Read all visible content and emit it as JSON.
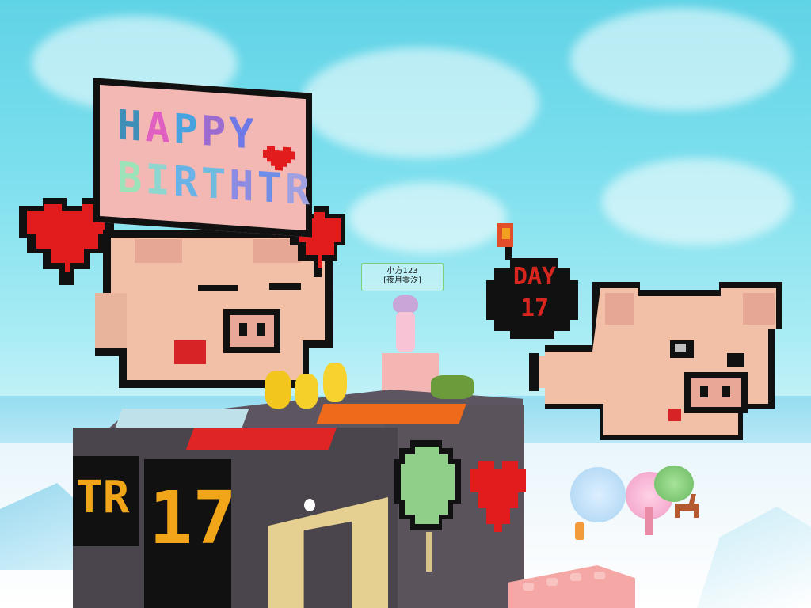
{
  "scene": {
    "sign": {
      "line1_letters": [
        "H",
        "A",
        "P",
        "P",
        "Y"
      ],
      "line1_colors": [
        "#3d8fb7",
        "#e060c2",
        "#47a2e0",
        "#9b6bd0",
        "#6e79e6"
      ],
      "line2_letters": [
        "B",
        "I",
        "R",
        "T",
        "H",
        "T",
        "R"
      ],
      "line2_colors": [
        "#9be3b9",
        "#8fd6d1",
        "#67b2e6",
        "#6dbce0",
        "#8e8ce2",
        "#6f8ee8",
        "#9ea0e2"
      ]
    },
    "bomb": {
      "line1": "DAY",
      "line2": "17"
    },
    "block": {
      "panel_left": "TR",
      "panel_right": "17"
    },
    "player": {
      "name": "小方123",
      "guild": "[夜月零汐]"
    }
  }
}
